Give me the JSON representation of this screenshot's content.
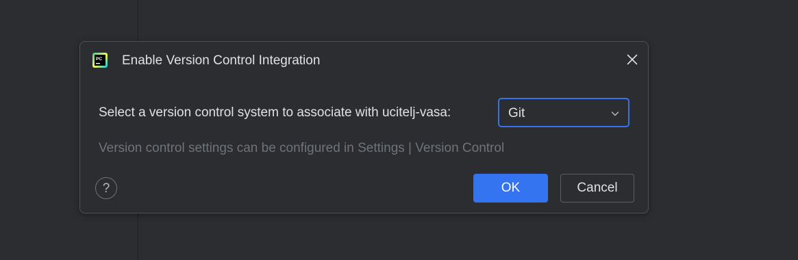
{
  "dialog": {
    "title": "Enable Version Control Integration",
    "app_icon": "pycharm-icon",
    "prompt": "Select a version control system to associate with ucitelj-vasa:",
    "vcs_selected": "Git",
    "hint": "Version control settings can be configured in Settings | Version Control",
    "help_label": "?",
    "ok_label": "OK",
    "cancel_label": "Cancel"
  },
  "colors": {
    "background": "#2b2d30",
    "accent": "#3574f0",
    "text": "#dfe1e5",
    "muted_text": "#6f737a",
    "border": "#4e5157"
  }
}
